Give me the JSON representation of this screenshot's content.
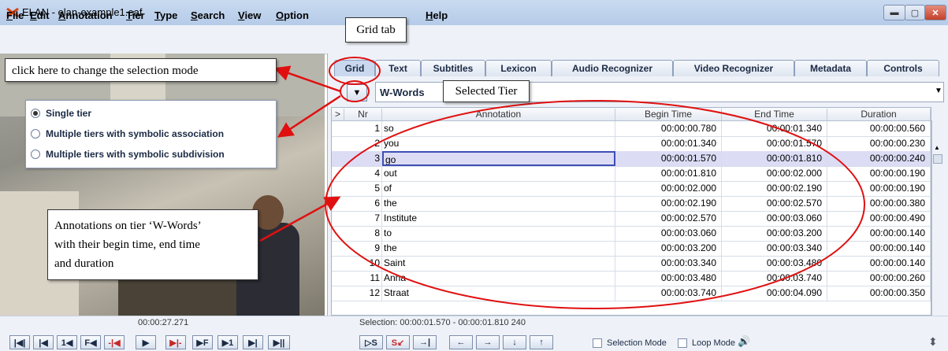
{
  "window": {
    "title": "ELAN - elan-example1.eaf",
    "minimize": "▬",
    "maximize": "▢",
    "close": "✕"
  },
  "menu": [
    "File",
    "Edit",
    "Annotation",
    "Tier",
    "Type",
    "Search",
    "View",
    "Option",
    "Help"
  ],
  "callouts": {
    "selection_mode": "click here to change the selection mode",
    "grid_tab": "Grid tab",
    "selected_tier": "Selected Tier",
    "annotations": [
      "Annotations on tier ‘W-Words’",
      "with their begin time, end time",
      "and duration"
    ]
  },
  "selection_modes": {
    "options": [
      "Single tier",
      "Multiple tiers with symbolic association",
      "Multiple tiers with symbolic subdivision"
    ],
    "selected_index": 0
  },
  "tabs": [
    "Grid",
    "Text",
    "Subtitles",
    "Lexicon",
    "Audio Recognizer",
    "Video Recognizer",
    "Metadata",
    "Controls"
  ],
  "active_tab": "Grid",
  "tier": {
    "button_icon": "▼",
    "value": "W-Words",
    "dropdown_icon": "▼"
  },
  "table": {
    "headers": [
      ">",
      "Nr",
      "Annotation",
      "Begin Time",
      "End Time",
      "Duration"
    ],
    "selected_row": 2,
    "rows": [
      {
        "nr": "1",
        "annotation": "so",
        "begin": "00:00:00.780",
        "end": "00:00:01.340",
        "duration": "00:00:00.560"
      },
      {
        "nr": "2",
        "annotation": "you",
        "begin": "00:00:01.340",
        "end": "00:00:01.570",
        "duration": "00:00:00.230"
      },
      {
        "nr": "3",
        "annotation": "go",
        "begin": "00:00:01.570",
        "end": "00:00:01.810",
        "duration": "00:00:00.240"
      },
      {
        "nr": "4",
        "annotation": "out",
        "begin": "00:00:01.810",
        "end": "00:00:02.000",
        "duration": "00:00:00.190"
      },
      {
        "nr": "5",
        "annotation": "of",
        "begin": "00:00:02.000",
        "end": "00:00:02.190",
        "duration": "00:00:00.190"
      },
      {
        "nr": "6",
        "annotation": "the",
        "begin": "00:00:02.190",
        "end": "00:00:02.570",
        "duration": "00:00:00.380"
      },
      {
        "nr": "7",
        "annotation": "Institute",
        "begin": "00:00:02.570",
        "end": "00:00:03.060",
        "duration": "00:00:00.490"
      },
      {
        "nr": "8",
        "annotation": "to",
        "begin": "00:00:03.060",
        "end": "00:00:03.200",
        "duration": "00:00:00.140"
      },
      {
        "nr": "9",
        "annotation": "the",
        "begin": "00:00:03.200",
        "end": "00:00:03.340",
        "duration": "00:00:00.140"
      },
      {
        "nr": "10",
        "annotation": "Saint",
        "begin": "00:00:03.340",
        "end": "00:00:03.480",
        "duration": "00:00:00.140"
      },
      {
        "nr": "11",
        "annotation": "Anna",
        "begin": "00:00:03.480",
        "end": "00:00:03.740",
        "duration": "00:00:00.260"
      },
      {
        "nr": "12",
        "annotation": "Straat",
        "begin": "00:00:03.740",
        "end": "00:00:04.090",
        "duration": "00:00:00.350"
      }
    ]
  },
  "media": {
    "current_time": "00:00:27.271",
    "selection": "Selection: 00:00:01.570 - 00:00:01.810  240"
  },
  "controls": {
    "playback": [
      "|◀|",
      "|◀",
      "1◀",
      "F◀",
      "-|◀",
      "▶",
      "▶|-",
      "▶F",
      "▶1",
      "▶|",
      "▶||"
    ],
    "selection": [
      "▷S",
      "S↙",
      "→|"
    ],
    "navigation": [
      "←",
      "→",
      "↓",
      "↑"
    ],
    "selection_mode_label": "Selection Mode",
    "loop_mode_label": "Loop Mode",
    "volume_icon": "🔊",
    "resize_icon": "⬍"
  },
  "colors": {
    "highlight_ellipse": "#e01010",
    "selected_row": "#dcdcf5",
    "ui_blue": "#1b2a44"
  }
}
